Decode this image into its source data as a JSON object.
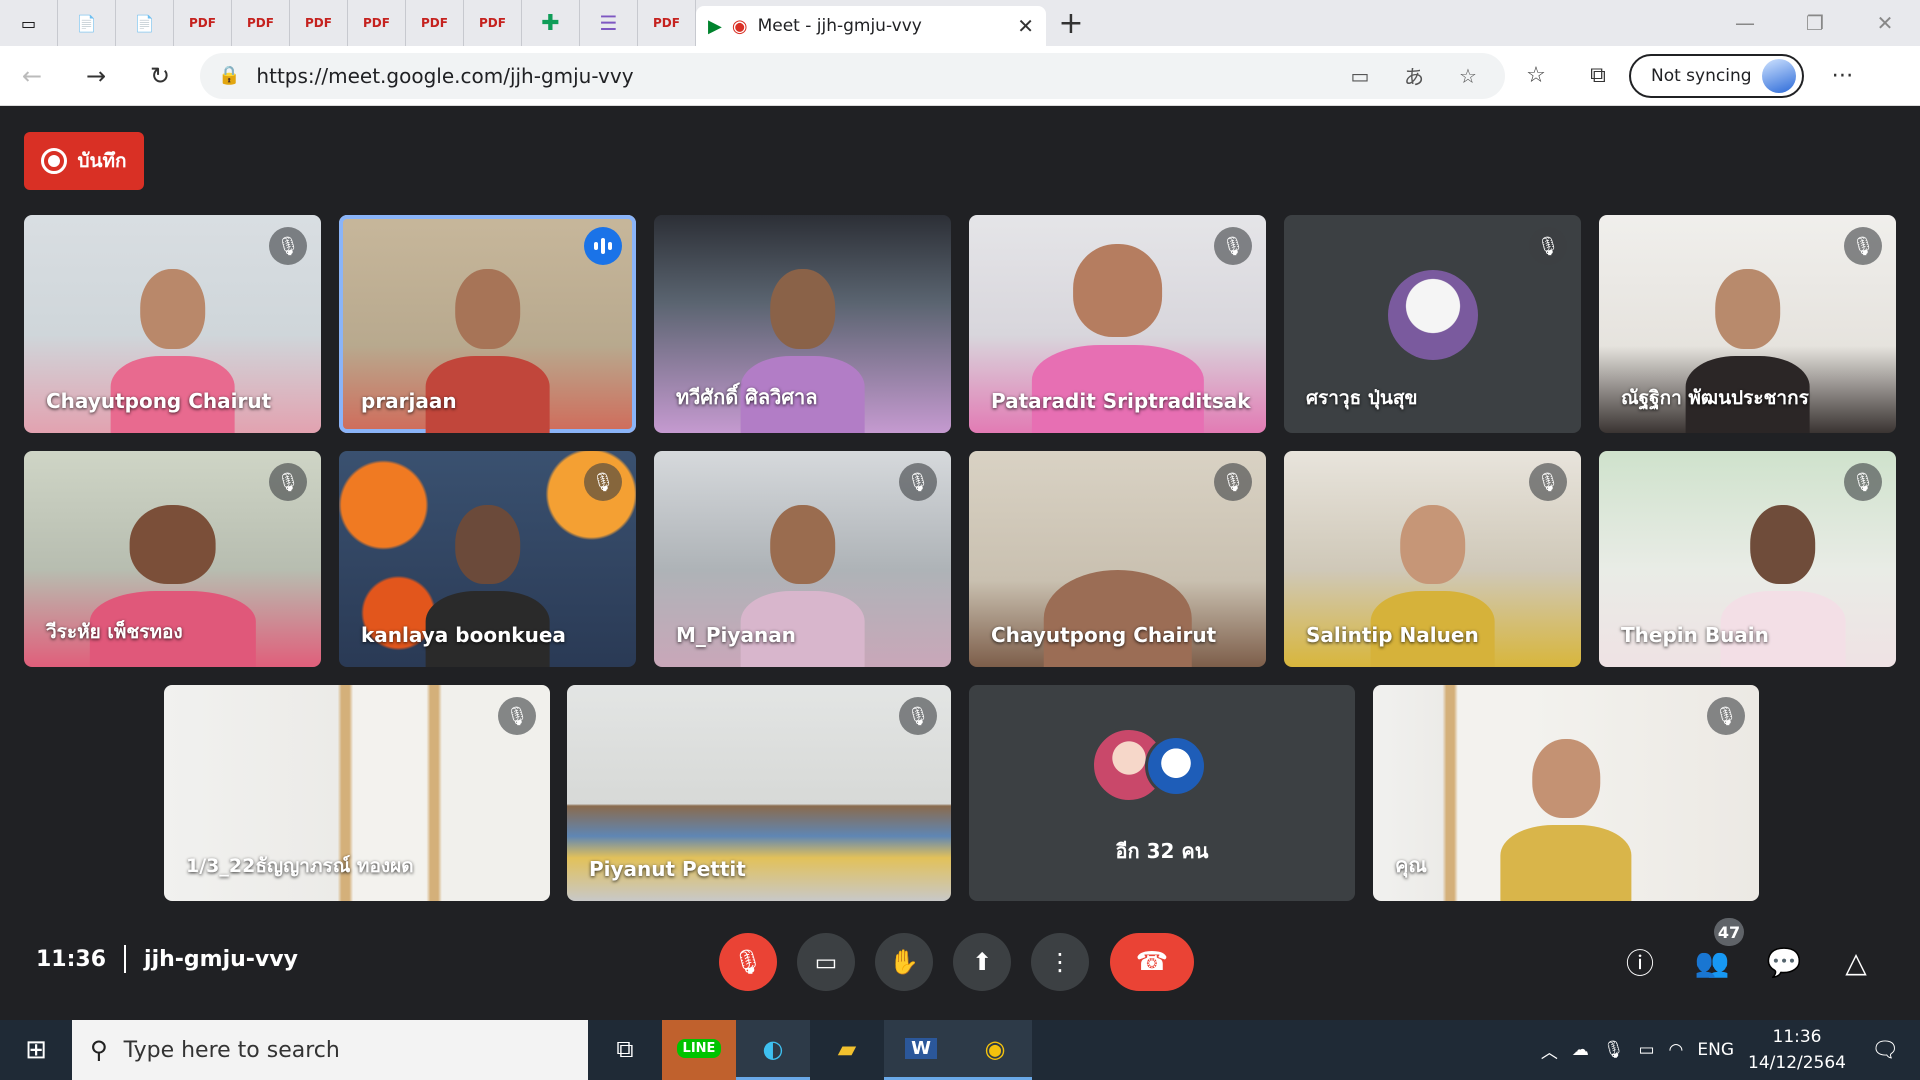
{
  "browser": {
    "tab_count_small": 11,
    "active_tab": {
      "title": "Meet - jjh-gmju-vvy"
    },
    "url": "https://meet.google.com/jjh-gmju-vvy",
    "sync_label": "Not syncing"
  },
  "meet": {
    "record_label": "บันทึก",
    "time": "11:36",
    "meeting_code": "jjh-gmju-vvy",
    "participant_count": "47",
    "others_label": "อีก 32 คน",
    "tiles": [
      {
        "name": "Chayutpong Chairut",
        "muted": true,
        "speaking": false
      },
      {
        "name": "prarjaan",
        "muted": false,
        "speaking": true
      },
      {
        "name": "ทวีศักดิ์ ศิลวิศาล",
        "muted": false,
        "speaking": false
      },
      {
        "name": "Pataradit Sriptraditsak",
        "muted": true,
        "speaking": false
      },
      {
        "name": "ศราวุธ ปุ่นสุข",
        "muted": true,
        "speaking": false
      },
      {
        "name": "ณัฐฐิกา พัฒนประชากร",
        "muted": true,
        "speaking": false
      },
      {
        "name": "วีระหัย เพ็ชรทอง",
        "muted": true,
        "speaking": false
      },
      {
        "name": "kanlaya boonkuea",
        "muted": true,
        "speaking": false
      },
      {
        "name": "M_Piyanan",
        "muted": true,
        "speaking": false
      },
      {
        "name": "Chayutpong Chairut",
        "muted": true,
        "speaking": false
      },
      {
        "name": "Salintip Naluen",
        "muted": true,
        "speaking": false
      },
      {
        "name": "Thepin Buain",
        "muted": true,
        "speaking": false
      },
      {
        "name": "1/3_22ธัญญาภรณ์ ทองผด",
        "muted": true,
        "speaking": false
      },
      {
        "name": "Piyanut Pettit",
        "muted": true,
        "speaking": false
      },
      {
        "name": "คุณ",
        "muted": true,
        "speaking": false
      }
    ]
  },
  "taskbar": {
    "search_placeholder": "Type here to search",
    "language": "ENG",
    "time": "11:36",
    "date": "14/12/2564"
  },
  "colors": {
    "meet_bg": "#202124",
    "tile_bg": "#3c4043",
    "accent_red": "#ea4335",
    "speaking_blue": "#1a73e8"
  }
}
